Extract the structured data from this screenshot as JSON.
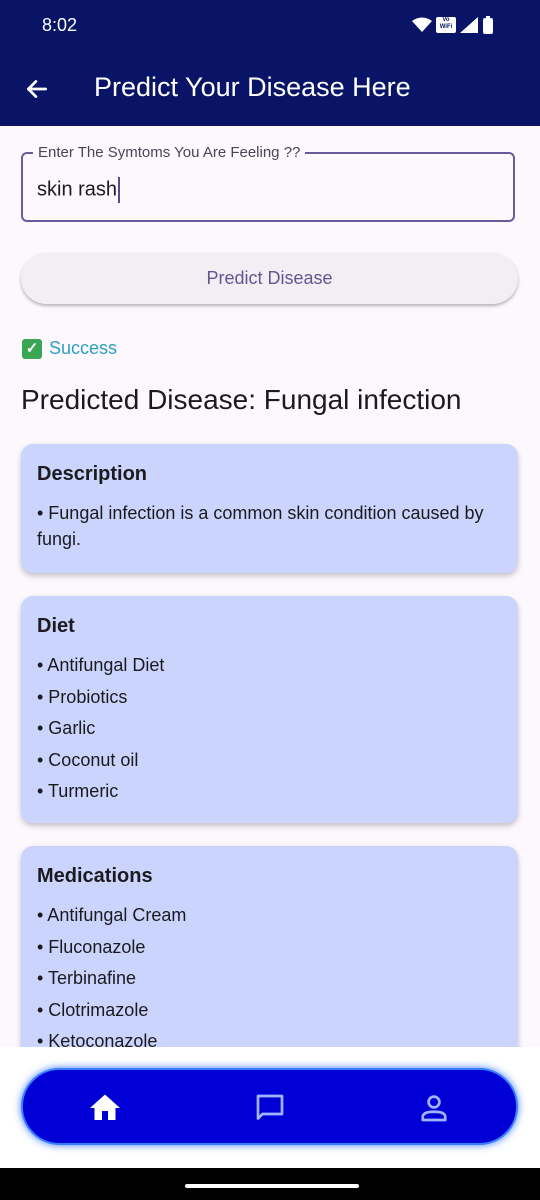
{
  "status_bar": {
    "time": "8:02",
    "vowifi_top": "Vo",
    "vowifi_bottom": "WiFi"
  },
  "app_bar": {
    "title": "Predict Your Disease Here"
  },
  "symptom_field": {
    "label": "Enter The Symtoms You Are Feeling ??",
    "value": "skin rash"
  },
  "predict_button": {
    "label": "Predict Disease"
  },
  "status": {
    "text": "Success"
  },
  "result": {
    "title": "Predicted Disease: Fungal infection"
  },
  "cards": {
    "description": {
      "title": "Description",
      "text": "• Fungal infection is a common skin condition caused by fungi."
    },
    "diet": {
      "title": "Diet",
      "items": [
        "• Antifungal Diet",
        "• Probiotics",
        "• Garlic",
        "• Coconut oil",
        "• Turmeric"
      ]
    },
    "medications": {
      "title": "Medications",
      "items": [
        "• Antifungal Cream",
        "• Fluconazole",
        "• Terbinafine",
        "• Clotrimazole",
        "• Ketoconazole"
      ]
    }
  },
  "bottom_nav": {
    "items": [
      "home-icon",
      "chat-icon",
      "profile-icon"
    ],
    "active": "home-icon"
  },
  "colors": {
    "app_bar": "#0a1466",
    "card": "#cad4fc",
    "nav": "#0000d6",
    "success": "#2e9fbf"
  }
}
